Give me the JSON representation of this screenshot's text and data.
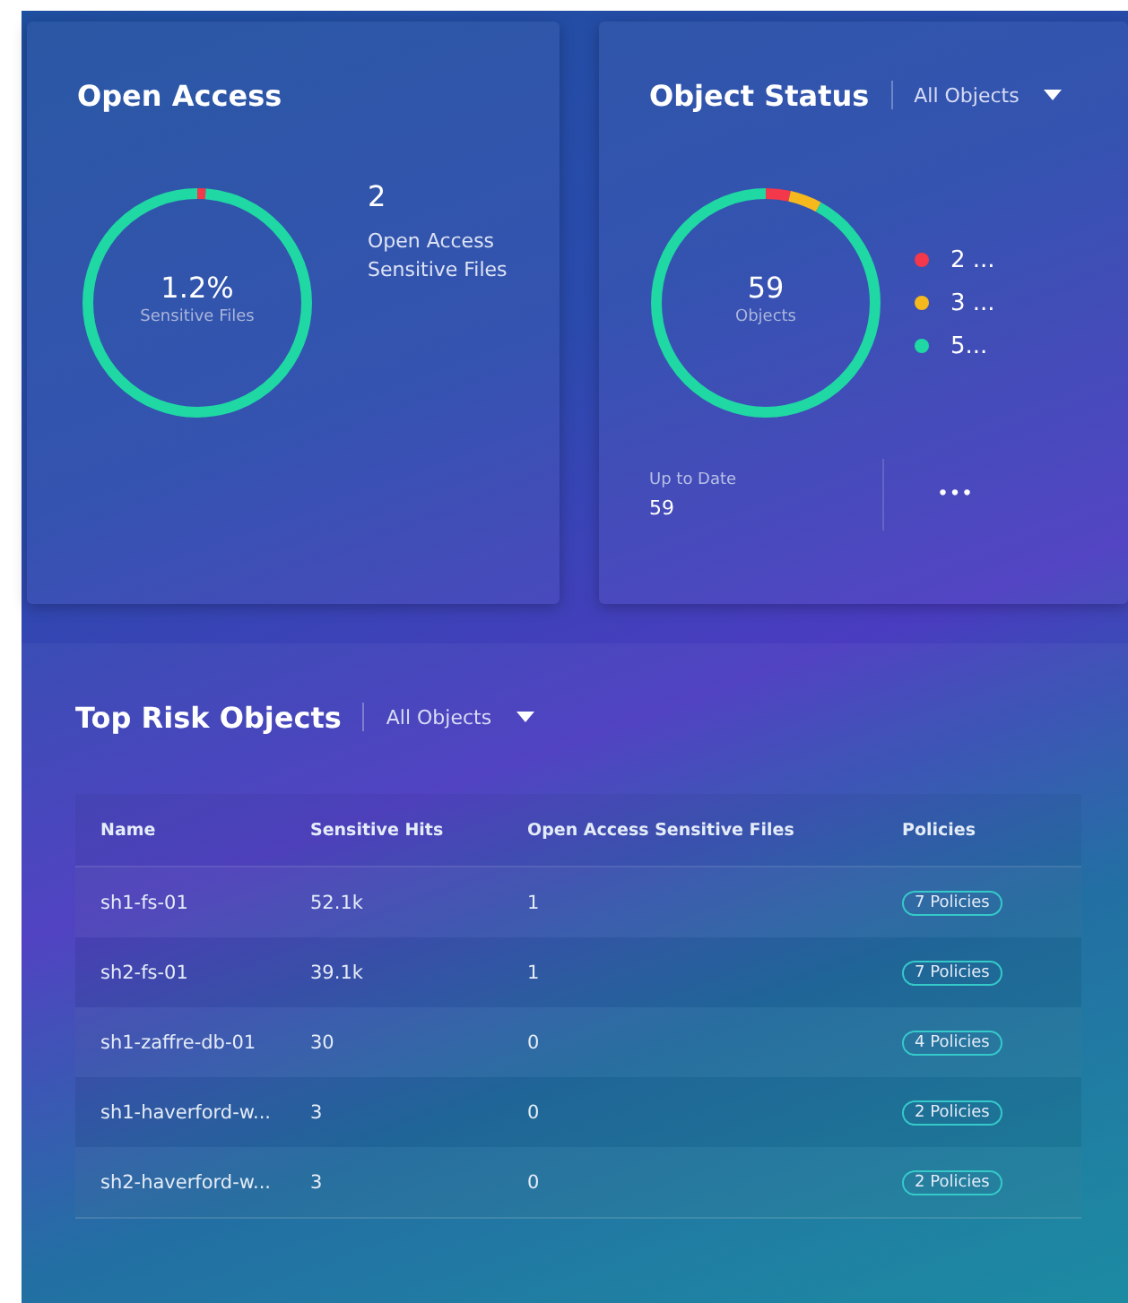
{
  "open_access": {
    "title": "Open Access",
    "center_value": "1.2%",
    "center_label": "Sensitive Files",
    "count": "2",
    "count_label": "Open Access Sensitive Files"
  },
  "object_status": {
    "title": "Object Status",
    "filter": "All Objects",
    "center_value": "59",
    "center_label": "Objects",
    "legend": [
      {
        "label": "2 ...",
        "color": "#f2384a"
      },
      {
        "label": "3 ...",
        "color": "#f5b91e"
      },
      {
        "label": "5...",
        "color": "#1fd8a4"
      }
    ],
    "stat_label": "Up to Date",
    "stat_value": "59",
    "more": "•••"
  },
  "top_risk": {
    "title": "Top Risk Objects",
    "filter": "All Objects",
    "columns": [
      "Name",
      "Sensitive Hits",
      "Open Access Sensitive Files",
      "Policies"
    ],
    "rows": [
      [
        "sh1-fs-01",
        "52.1k",
        "1",
        "7 Policies"
      ],
      [
        "sh2-fs-01",
        "39.1k",
        "1",
        "7 Policies"
      ],
      [
        "sh1-zaffre-db-01",
        "30",
        "0",
        "4 Policies"
      ],
      [
        "sh1-haverford-w...",
        "3",
        "0",
        "2 Policies"
      ],
      [
        "sh2-haverford-w...",
        "3",
        "0",
        "2 Policies"
      ]
    ]
  }
}
